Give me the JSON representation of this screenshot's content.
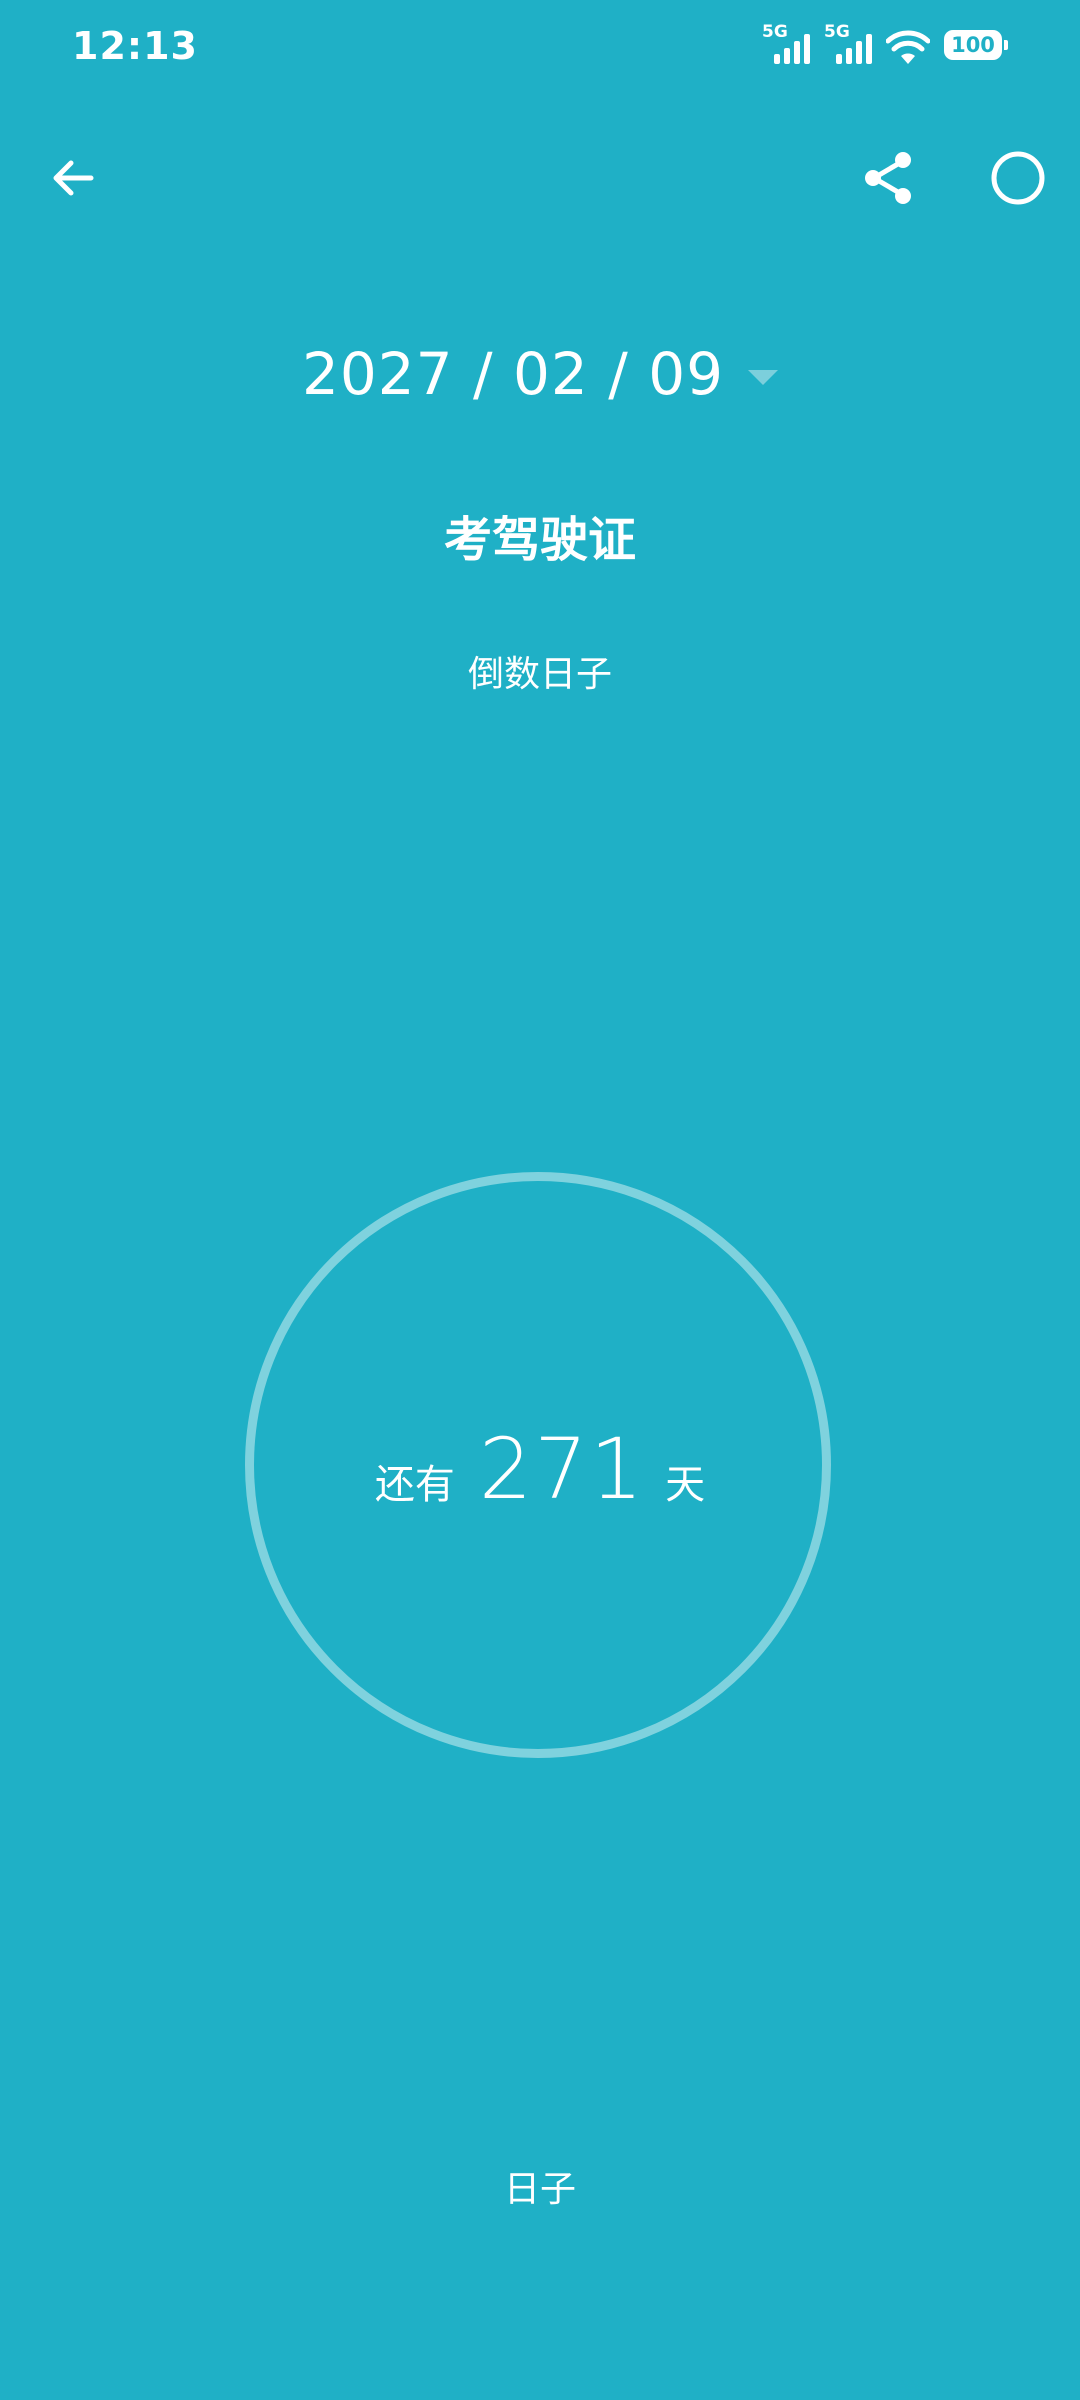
{
  "status_bar": {
    "time": "12:13",
    "network1": "5G",
    "network2": "5G",
    "battery": "100"
  },
  "toolbar": {
    "back_icon": "arrow-left-icon",
    "share_icon": "share-icon",
    "more_icon": "circle-icon"
  },
  "event": {
    "date": "2027 / 02 / 09",
    "title": "考驾驶证",
    "type": "倒数日子"
  },
  "countdown": {
    "prefix": "还有",
    "days": "271",
    "suffix": "天"
  },
  "footer": {
    "label": "日子"
  },
  "colors": {
    "background": "#1fb0c6",
    "ring": "#7fd2de",
    "caret": "#7ccfdc",
    "foreground": "#ffffff"
  }
}
